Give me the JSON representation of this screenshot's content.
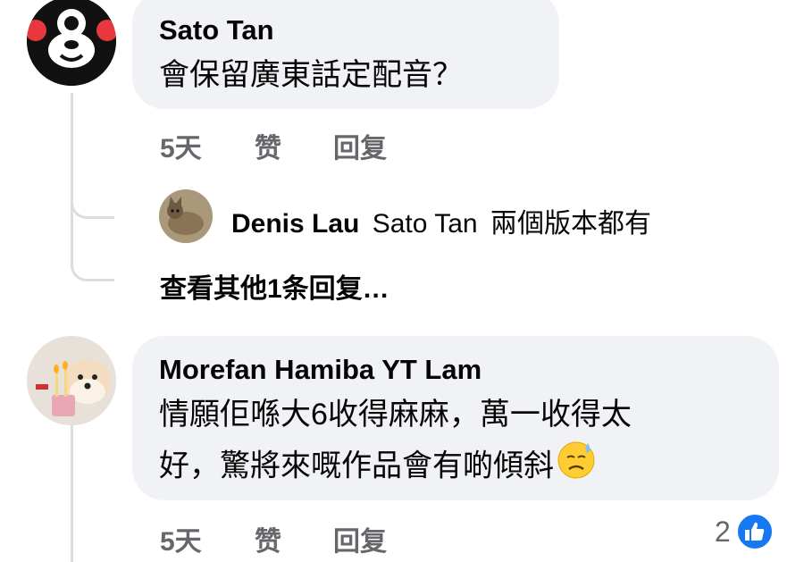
{
  "comments": [
    {
      "author": "Sato Tan",
      "text": "會保留廣東話定配音？",
      "time": "5天",
      "like_label": "赞",
      "reply_label": "回复",
      "avatar_icon": "kumamon-avatar"
    },
    {
      "author": "Morefan Hamiba YT Lam",
      "text_line1": "情願佢喺大6收得麻麻，萬一收得太",
      "text_line2": "好，驚將來嘅作品會有啲傾斜",
      "emoji": "downcast-face-with-sweat-icon",
      "time": "5天",
      "like_label": "赞",
      "reply_label": "回复",
      "reaction_count": "2",
      "reaction_icon": "like-icon",
      "avatar_icon": "dog-avatar"
    }
  ],
  "reply": {
    "author": "Denis Lau",
    "mention": "Sato Tan",
    "text": "兩個版本都有",
    "avatar_icon": "cat-avatar"
  },
  "view_more": "查看其他1条回复…",
  "colors": {
    "bubble": "#f0f2f5",
    "meta": "#65676b",
    "like_blue": "#1877f2"
  }
}
